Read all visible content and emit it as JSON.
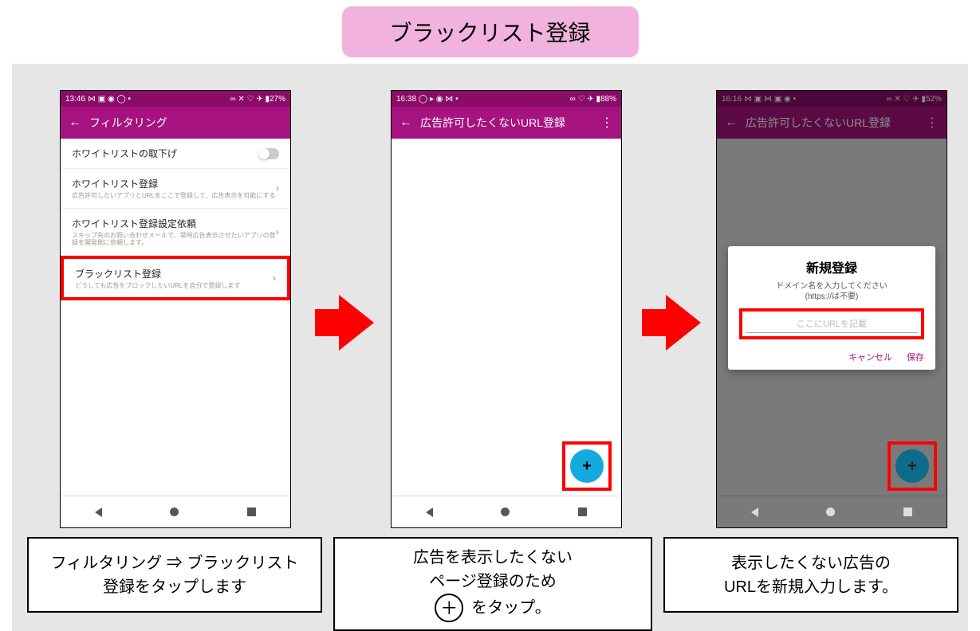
{
  "banner": "ブラックリスト登録",
  "phone1": {
    "time": "13:46",
    "status_right": "∞ ✕ ♡ ✈ ▮27%",
    "title": "フィルタリング",
    "items": [
      {
        "label": "ホワイトリストの取下げ",
        "sub": ""
      },
      {
        "label": "ホワイトリスト登録",
        "sub": "広告許可したいアプリとURLをここで登録して、広告表示を可能にする"
      },
      {
        "label": "ホワイトリスト登録設定依頼",
        "sub": "スキップ先のお問い合わせメールで、常時広告表示させたいアプリの登録を開発側に依頼します。"
      },
      {
        "label": "ブラックリスト登録",
        "sub": "どうしても広告をブロックしたいURLを自分で登録します"
      }
    ]
  },
  "phone2": {
    "time": "16:38",
    "status_right": "∞ ♡ ✈ ▮88%",
    "title": "広告許可したくないURL登録"
  },
  "phone3": {
    "time": "16:16",
    "status_right": "∞ ✕ ♡ ✈ ▮52%",
    "title": "広告許可したくないURL登録",
    "dialog": {
      "title": "新規登録",
      "sub1": "ドメイン名を入力してください",
      "sub2": "(https://は不要)",
      "placeholder": "ここにURLを記載",
      "cancel": "キャンセル",
      "save": "保存"
    }
  },
  "captions": {
    "c1a": "フィルタリング ⇒ ブラックリスト",
    "c1b": "登録をタップします",
    "c2a": "広告を表示したくない",
    "c2b": "ページ登録のため",
    "c2c": "をタップ。",
    "c3a": "表示したくない広告の",
    "c3b": "URLを新規入力します。"
  }
}
